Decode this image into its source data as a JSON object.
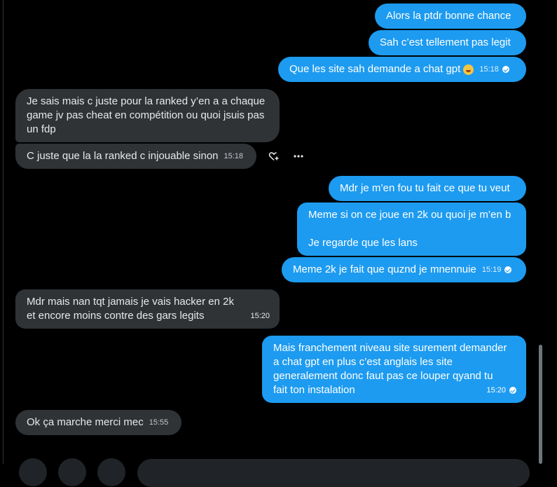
{
  "messages": {
    "m1": {
      "text": "Alors la ptdr bonne chance"
    },
    "m2": {
      "text": "Sah c’est tellement pas legit"
    },
    "m3": {
      "text": "Que les site sah demande a chat gpt",
      "time": "15:18",
      "emoji": "rolling-laughing-emoji"
    },
    "m4": {
      "text": "Je sais mais c juste pour la ranked y’en a a chaque game jv pas cheat en compétition ou quoi jsuis pas un fdp"
    },
    "m5": {
      "text": "C juste que la la ranked c injouable sinon",
      "time": "15:18"
    },
    "m6": {
      "text": "Mdr je m’en fou tu fait ce que tu veut"
    },
    "m7": {
      "line1": "Meme si on ce joue en 2k ou quoi je m’en b",
      "line2": "Je regarde que les lans"
    },
    "m8": {
      "text": "Meme 2k je fait que quznd je mnennuie",
      "time": "15:19"
    },
    "m9": {
      "text": "Mdr mais nan tqt jamais je vais hacker en 2k et encore moins contre des gars legits",
      "time": "15:20"
    },
    "m10": {
      "text": "Mais franchement niveau site surement demander a chat gpt en plus c’est anglais les site generalement donc faut pas ce louper qyand tu fait ton instalation",
      "time": "15:20"
    },
    "m11": {
      "text": "Ok ça marche merci mec",
      "time": "15:55"
    }
  },
  "actions": {
    "react_icon": "heart-plus-icon",
    "more_icon": "more-dots-icon"
  },
  "colors": {
    "outgoing": "#1d9bf0",
    "incoming": "#2f3336",
    "background": "#000000"
  }
}
